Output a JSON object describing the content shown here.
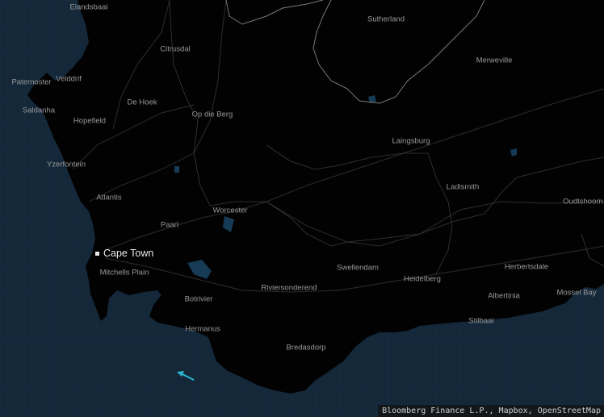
{
  "map": {
    "colors": {
      "land": "#020202",
      "ocean": "#14283a",
      "border": "#8a8a8a",
      "road": "#2a2a2a",
      "water": "#173a55",
      "arrow": "#2ab6d0"
    },
    "capital": {
      "name": "Cape Town"
    },
    "places": [
      {
        "id": "elandsbaai",
        "name": "Elandsbaai"
      },
      {
        "id": "sutherland",
        "name": "Sutherland"
      },
      {
        "id": "citrusdal",
        "name": "Citrusdal"
      },
      {
        "id": "merweville",
        "name": "Merweville"
      },
      {
        "id": "paternoster",
        "name": "Paternoster"
      },
      {
        "id": "velddrif",
        "name": "Velddrif"
      },
      {
        "id": "saldanha",
        "name": "Saldanha"
      },
      {
        "id": "de-hoek",
        "name": "De Hoek"
      },
      {
        "id": "op-die-berg",
        "name": "Op die Berg"
      },
      {
        "id": "hopefield",
        "name": "Hopefield"
      },
      {
        "id": "laingsburg",
        "name": "Laingsburg"
      },
      {
        "id": "yzerfontein",
        "name": "Yzerfontein"
      },
      {
        "id": "ladismith",
        "name": "Ladismith"
      },
      {
        "id": "atlantis",
        "name": "Atlantis"
      },
      {
        "id": "oudtshoorn",
        "name": "Oudtshoorn"
      },
      {
        "id": "worcester",
        "name": "Worcester"
      },
      {
        "id": "paarl",
        "name": "Paarl"
      },
      {
        "id": "swellendam",
        "name": "Swellendam"
      },
      {
        "id": "herbertsdale",
        "name": "Herbertsdale"
      },
      {
        "id": "mitchells-plain",
        "name": "Mitchells Plain"
      },
      {
        "id": "heidelberg",
        "name": "Heidelberg"
      },
      {
        "id": "riviersonderend",
        "name": "Riviersonderend"
      },
      {
        "id": "mossel-bay",
        "name": "Mossel Bay"
      },
      {
        "id": "albertinia",
        "name": "Albertinia"
      },
      {
        "id": "botrivier",
        "name": "Botrivier"
      },
      {
        "id": "stilbaai",
        "name": "Stilbaai"
      },
      {
        "id": "hermanus",
        "name": "Hermanus"
      },
      {
        "id": "bredasdorp",
        "name": "Bredasdorp"
      }
    ],
    "attribution": "Bloomberg Finance L.P., Mapbox, OpenStreetMap"
  }
}
